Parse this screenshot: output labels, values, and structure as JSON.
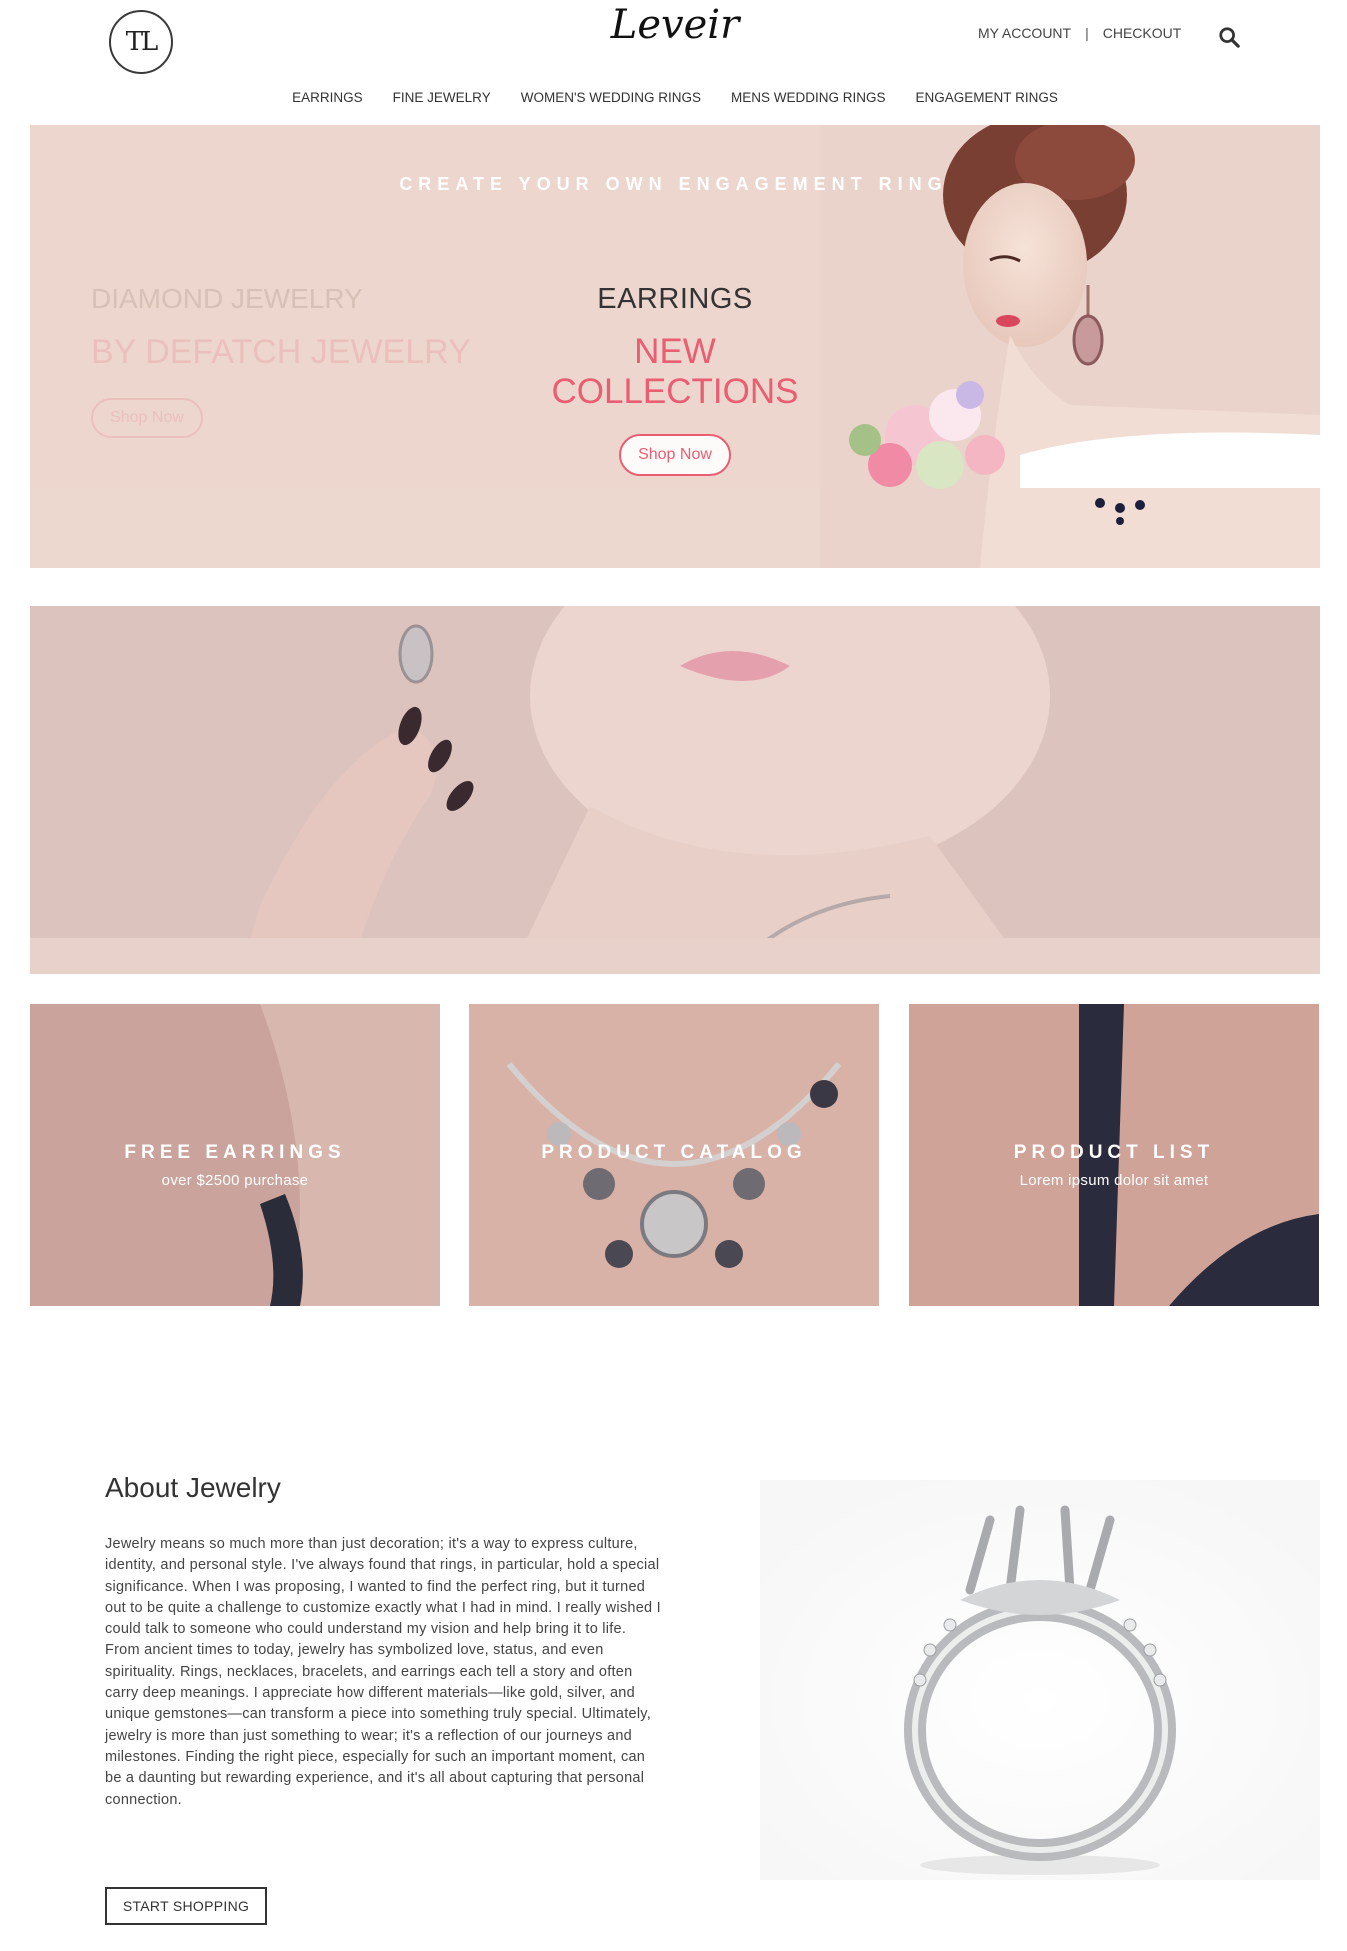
{
  "header": {
    "brand": "Leveir",
    "logo_mark": "TL",
    "my_account": "MY ACCOUNT",
    "separator": "|",
    "checkout": "CHECKOUT",
    "search_icon": "search-icon"
  },
  "nav": {
    "items": [
      {
        "label": "EARRINGS"
      },
      {
        "label": "FINE JEWELRY"
      },
      {
        "label": "WOMEN'S WEDDING RINGS"
      },
      {
        "label": "MENS WEDDING RINGS"
      },
      {
        "label": "ENGAGEMENT RINGS"
      }
    ]
  },
  "hero": {
    "ghost_title": "DIAMOND JEWELRY",
    "ghost_subtitle": "BY DEFATCH JEWELRY",
    "ghost_button": "Shop Now",
    "title": "EARRINGS",
    "subtitle": "NEW COLLECTIONS",
    "button": "Shop Now"
  },
  "banner2": {
    "text": "CREATE YOUR OWN ENGAGEMENT RING"
  },
  "tiles": [
    {
      "title": "FREE EARRINGS",
      "subtitle": "over $2500 purchase"
    },
    {
      "title": "PRODUCT CATALOG",
      "subtitle": ""
    },
    {
      "title": "PRODUCT LIST",
      "subtitle": "Lorem ipsum dolor sit amet"
    }
  ],
  "about": {
    "title": "About Jewelry",
    "text": "Jewelry means so much more than just decoration; it's a way to express culture, identity, and personal style. I've always found that rings, in particular, hold a special significance. When I was proposing, I wanted to find the perfect ring, but it turned out to be quite a challenge to customize exactly what I had in mind. I really wished I could talk to someone who could understand my vision and help bring it to life. From ancient times to today, jewelry has symbolized love, status, and even spirituality. Rings, necklaces, bracelets, and earrings each tell a story and often carry deep meanings. I appreciate how different materials—like gold, silver, and unique gemstones—can transform a piece into something truly special. Ultimately, jewelry is more than just something to wear; it's a reflection of our journeys and milestones. Finding the right piece, especially for such an important moment, can be a daunting but rewarding experience, and it's all about capturing that personal connection.",
    "button": "START SHOPPING"
  },
  "colors": {
    "accent_pink": "#e95e73",
    "hero_bg": "#ecd6cd",
    "text_dark": "#333333"
  }
}
